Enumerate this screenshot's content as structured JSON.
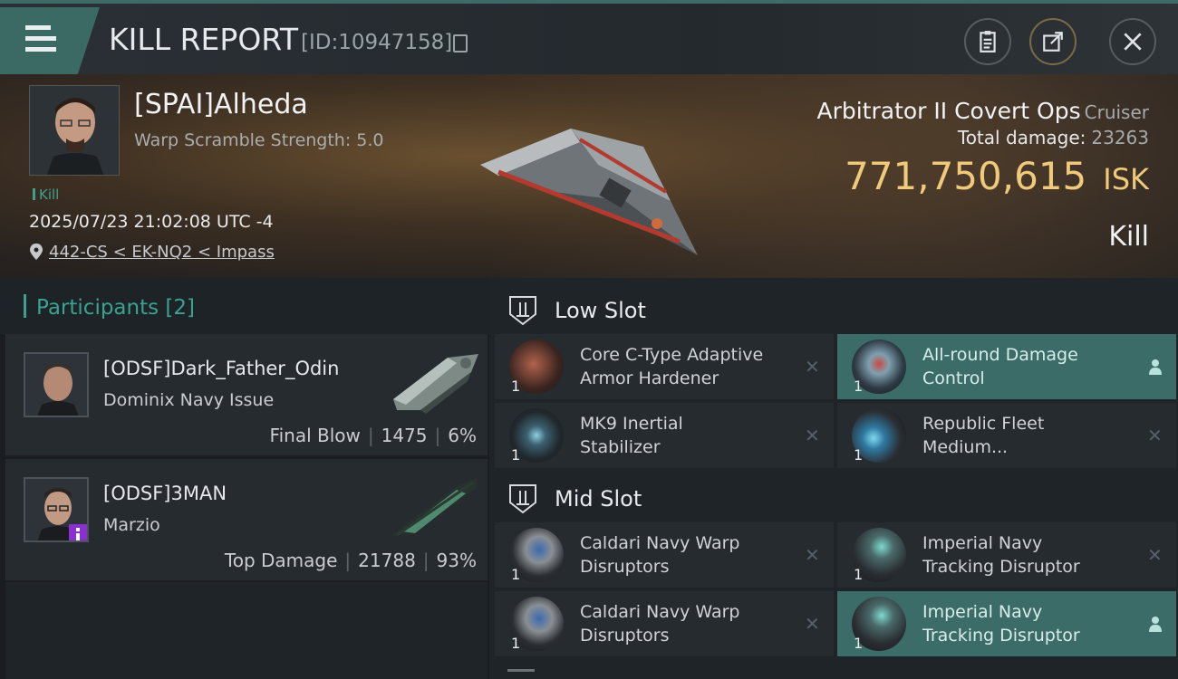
{
  "header": {
    "title": "KILL REPORT",
    "report_id": "[ID:10947158]"
  },
  "victim": {
    "name": "[SPAI]Alheda",
    "warp_scramble": "Warp Scramble Strength: 5.0",
    "kill_tag": "Kill",
    "datetime": "2025/07/23 21:02:08 UTC -4",
    "location": "442-CS < EK-NQ2 < Impass",
    "ship_name": "Arbitrator II Covert Ops",
    "ship_class": "Cruiser",
    "total_damage_label": "Total damage:",
    "total_damage": "23263",
    "isk_value": "771,750,615",
    "isk_unit": "ISK",
    "result": "Kill"
  },
  "participants": {
    "title": "Participants",
    "count": "[2]",
    "items": [
      {
        "name": "[ODSF]Dark_Father_Odin",
        "ship": "Dominix Navy Issue",
        "role": "Final Blow",
        "damage": "1475",
        "percent": "6%"
      },
      {
        "name": "[ODSF]3MAN",
        "ship": "Marzio",
        "role": "Top Damage",
        "damage": "21788",
        "percent": "93%"
      }
    ]
  },
  "slots": {
    "low": {
      "title": "Low Slot",
      "modules": [
        {
          "name": "Core C-Type Adaptive Armor Hardener",
          "line1": "Core C-Type Adaptive",
          "line2": " Armor Hardener",
          "qty": "1",
          "state": "destroyed"
        },
        {
          "name": "All-round Damage Control",
          "line1": "All-round Damage",
          "line2": "Control",
          "qty": "1",
          "state": "dropped"
        },
        {
          "name": "MK9 Inertial Stabilizer",
          "line1": "MK9 Inertial",
          "line2": "Stabilizer",
          "qty": "1",
          "state": "destroyed"
        },
        {
          "name": "Republic Fleet Medium...",
          "line1": "Republic Fleet",
          "line2": "Medium...",
          "qty": "1",
          "state": "destroyed"
        }
      ]
    },
    "mid": {
      "title": "Mid Slot",
      "modules": [
        {
          "name": "Caldari Navy Warp Disruptors",
          "line1": "Caldari Navy Warp",
          "line2": "Disruptors",
          "qty": "1",
          "state": "destroyed"
        },
        {
          "name": "Imperial Navy Tracking Disruptor",
          "line1": "Imperial Navy",
          "line2": "Tracking Disruptor",
          "qty": "1",
          "state": "destroyed"
        },
        {
          "name": "Caldari Navy Warp Disruptors",
          "line1": "Caldari Navy Warp",
          "line2": "Disruptors",
          "qty": "1",
          "state": "destroyed"
        },
        {
          "name": "Imperial Navy Tracking Disruptor",
          "line1": "Imperial Navy",
          "line2": "Tracking Disruptor",
          "qty": "1",
          "state": "dropped"
        }
      ]
    }
  },
  "colors": {
    "accent_teal": "#3b6c67",
    "isk_gold": "#f0c97a",
    "participant_title": "#39a291"
  },
  "icons": {
    "menu": "hamburger-menu-icon",
    "copy": "copy-icon",
    "clipboard": "clipboard-icon",
    "share": "share-icon",
    "close": "close-icon",
    "location": "location-pin-icon",
    "slot": "slot-icon",
    "destroyed": "destroyed-x-icon",
    "dropped": "person-icon"
  }
}
